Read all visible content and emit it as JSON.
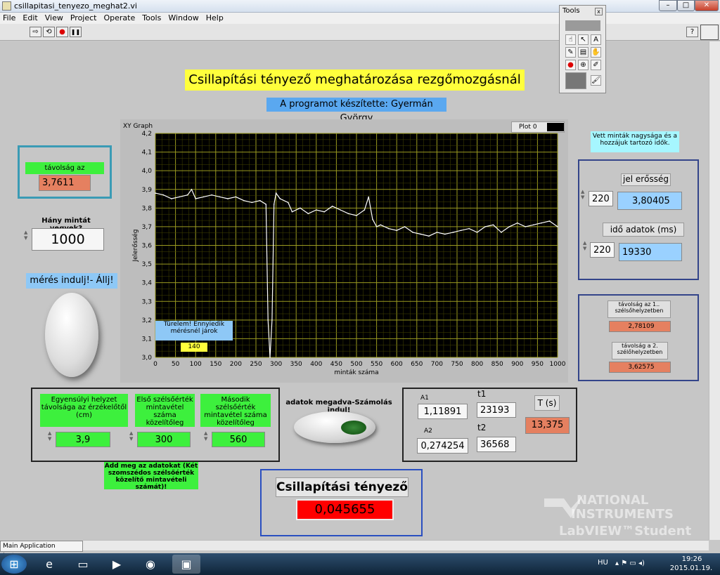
{
  "window": {
    "title": "csillapitasi_tenyezo_meghat2.vi",
    "min": "–",
    "max": "□",
    "close": "✕"
  },
  "menu": [
    "File",
    "Edit",
    "View",
    "Project",
    "Operate",
    "Tools",
    "Window",
    "Help"
  ],
  "toolbar": {
    "run": "⇨",
    "run_cont": "⟲",
    "abort": "●",
    "pause": "❚❚",
    "help": "?"
  },
  "tools_palette": {
    "title": "Tools",
    "close": "x"
  },
  "front": {
    "title": "Csillapítási tényező meghatározása rezgőmozgásnál",
    "author": "A programot készítette: Gyermán György",
    "dist_label": "távolság az érzékelőtől",
    "dist_value": "3,7611",
    "samples_label": "Hány mintát vegyek?",
    "samples_value": "1000",
    "start_label": "mérés indulj!- Állj!",
    "sample_info": "Vett minták nagysága és a hozzájuk tartozó idők.",
    "signal_label": "jel erősség",
    "signal_index": "220",
    "signal_value": "3,80405",
    "time_label": "idő adatok (ms)",
    "time_index": "220",
    "time_value": "19330",
    "ext1_label": "távolság az 1.. szélsőhelyzetben",
    "ext1_value": "2,78109",
    "ext2_label": "távolság a 2. szélőhelyzetben",
    "ext2_value": "3,62575",
    "eq_label": "Egyensúlyi helyzet távolsága az érzékelőtől (cm)",
    "eq_value": "3,9",
    "first_label": "Első szélsőérték mintavétel száma közelítőleg",
    "first_value": "300",
    "second_label": "Második szélsőérték mintavétel száma közelítőleg",
    "second_value": "560",
    "note": "Add meg az adatokat (Két szomszédos szélsőérték közelítő mintavételi számát)!",
    "calc_label": "adatok megadva-Számolás indul!",
    "a1_label": "A1",
    "a1_value": "1,11891",
    "a2_label": "A2",
    "a2_value": "0,274254",
    "t1_label": "t1",
    "t1_value": "23193",
    "t2_label": "t2",
    "t2_value": "36568",
    "T_label": "T (s)",
    "T_value": "13,375",
    "damp_label": "Csillapítási tényező",
    "damp_value": "0,045655",
    "wait_text": "Türelem! Ennyiedik mérésnél járok",
    "wait_value": "140",
    "ni_line1": "NATIONAL",
    "ni_line2": "INSTRUMENTS",
    "ni_line3": "LabVIEW™Student Edition",
    "status": "Main Application Instance"
  },
  "chart_data": {
    "type": "line",
    "title": "XY Graph",
    "legend": "Plot 0",
    "xlabel": "minták száma",
    "ylabel": "Jelerősség",
    "xlim": [
      0,
      1000
    ],
    "ylim": [
      3.0,
      4.2
    ],
    "xticks": [
      "0",
      "50",
      "100",
      "150",
      "200",
      "250",
      "300",
      "350",
      "400",
      "450",
      "500",
      "550",
      "600",
      "650",
      "700",
      "750",
      "800",
      "850",
      "900",
      "950",
      "1000"
    ],
    "yticks": [
      "3,0",
      "3,1",
      "3,2",
      "3,3",
      "3,4",
      "3,5",
      "3,6",
      "3,7",
      "3,8",
      "3,9",
      "4,0",
      "4,1",
      "4,2"
    ],
    "series": [
      {
        "x": [
          0,
          20,
          40,
          60,
          80,
          90,
          100,
          120,
          140,
          160,
          180,
          200,
          220,
          240,
          260,
          275,
          280,
          285,
          290,
          295,
          300,
          310,
          330,
          340,
          360,
          380,
          400,
          420,
          440,
          460,
          480,
          500,
          520,
          530,
          540,
          550,
          560,
          580,
          600,
          620,
          640,
          660,
          680,
          700,
          720,
          740,
          760,
          780,
          800,
          820,
          840,
          860,
          880,
          900,
          920,
          940,
          960,
          980,
          1000
        ],
        "y": [
          3.88,
          3.87,
          3.85,
          3.86,
          3.87,
          3.9,
          3.85,
          3.86,
          3.87,
          3.86,
          3.85,
          3.86,
          3.84,
          3.83,
          3.84,
          3.82,
          3.2,
          3.0,
          3.2,
          3.82,
          3.88,
          3.85,
          3.83,
          3.78,
          3.8,
          3.77,
          3.79,
          3.78,
          3.81,
          3.79,
          3.77,
          3.76,
          3.79,
          3.86,
          3.74,
          3.7,
          3.71,
          3.69,
          3.68,
          3.7,
          3.67,
          3.66,
          3.65,
          3.67,
          3.66,
          3.67,
          3.68,
          3.69,
          3.67,
          3.7,
          3.71,
          3.67,
          3.7,
          3.72,
          3.7,
          3.71,
          3.72,
          3.73,
          3.7
        ]
      }
    ]
  },
  "taskbar": {
    "lang": "HU",
    "time": "19:26",
    "date": "2015.01.19."
  }
}
